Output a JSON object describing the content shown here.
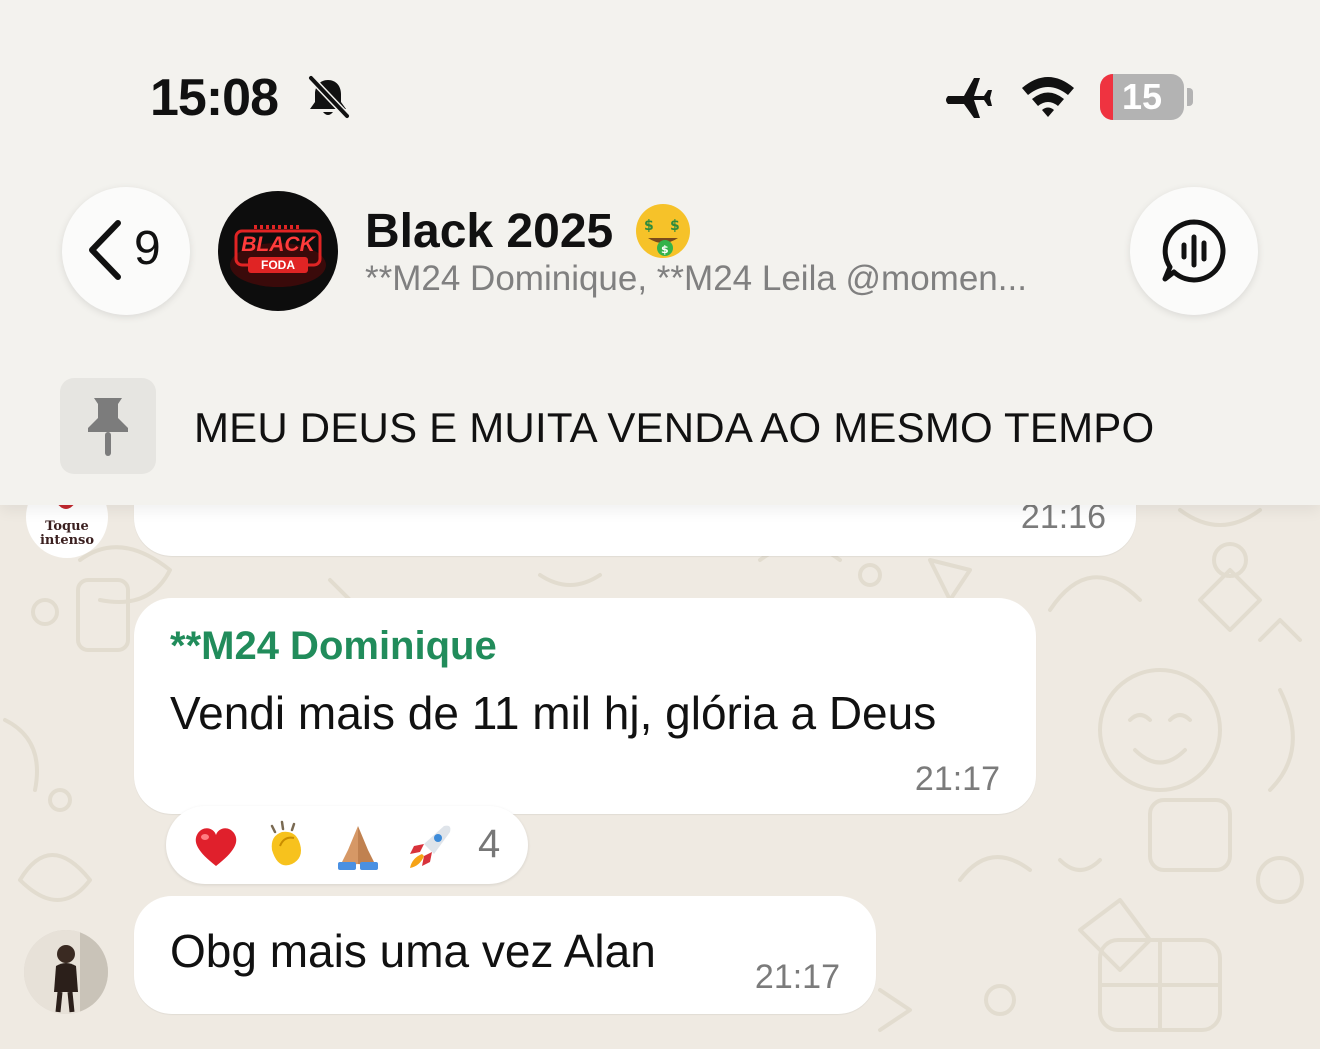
{
  "status_bar": {
    "time": "15:08",
    "battery_level": "15",
    "battery_fraction": 0.15,
    "icons": [
      "bell-slash-icon",
      "airplane-icon",
      "wifi-icon",
      "battery-icon"
    ]
  },
  "header": {
    "back_count": "9",
    "group_title": "Black 2025",
    "group_emoji": "money-mouth-face-emoji",
    "group_subtitle": "**M24 Dominique, **M24 Leila @momen...",
    "avatar_logo_line1": "BLACK",
    "avatar_logo_line2": "FODA",
    "call_icon": "voice-chat-icon"
  },
  "pinned": {
    "icon": "pin-icon",
    "text": "MEU DEUS E MUITA VENDA AO MESMO TEMPO"
  },
  "messages": [
    {
      "time": "21:16",
      "avatar_label_line1": "Toque",
      "avatar_label_line2": "intenso"
    },
    {
      "sender": "**M24 Dominique",
      "text": "Vendi mais de 11 mil hj, glória a Deus",
      "time": "21:17",
      "reactions": [
        "red-heart",
        "clapping-hands",
        "folded-hands",
        "rocket"
      ],
      "reaction_count": "4"
    },
    {
      "text": "Obg mais uma vez Alan",
      "time": "21:17"
    }
  ],
  "colors": {
    "sender_name": "#218c5b",
    "battery_low": "#ef3340",
    "wallpaper": "#efeae2",
    "header_bg": "#f3f2ee"
  }
}
